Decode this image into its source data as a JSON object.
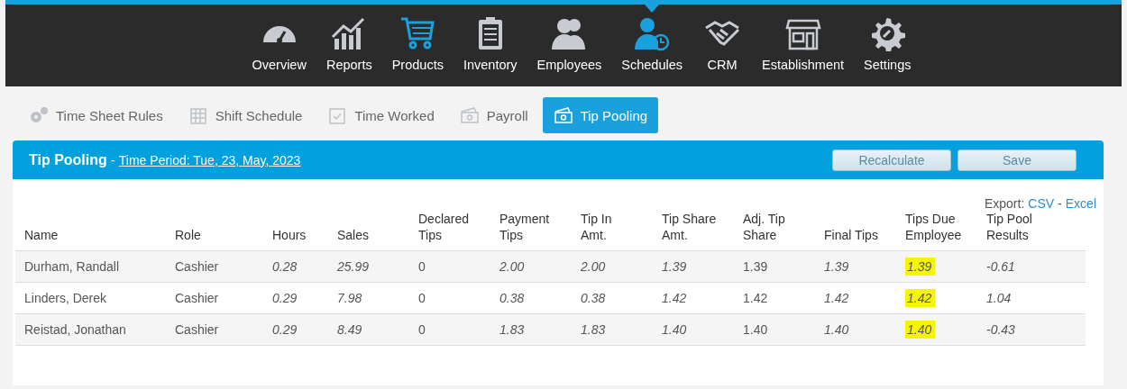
{
  "nav": [
    {
      "label": "Overview",
      "selected": false,
      "highlighted": false
    },
    {
      "label": "Reports",
      "selected": false,
      "highlighted": false
    },
    {
      "label": "Products",
      "selected": false,
      "highlighted": true
    },
    {
      "label": "Inventory",
      "selected": false,
      "highlighted": false
    },
    {
      "label": "Employees",
      "selected": false,
      "highlighted": false
    },
    {
      "label": "Schedules",
      "selected": true,
      "highlighted": false
    },
    {
      "label": "CRM",
      "selected": false,
      "highlighted": false
    },
    {
      "label": "Establishment",
      "selected": false,
      "highlighted": false
    },
    {
      "label": "Settings",
      "selected": false,
      "highlighted": false
    }
  ],
  "subtabs": [
    {
      "label": "Time Sheet Rules",
      "selected": false
    },
    {
      "label": "Shift Schedule",
      "selected": false
    },
    {
      "label": "Time Worked",
      "selected": false
    },
    {
      "label": "Payroll",
      "selected": false
    },
    {
      "label": "Tip Pooling",
      "selected": true
    }
  ],
  "panel": {
    "title": "Tip Pooling",
    "separator": "-",
    "period_link": "Time Period: Tue, 23, May, 2023",
    "buttons": [
      "Recalculate",
      "Save"
    ]
  },
  "export": {
    "label": "Export:",
    "links": [
      "CSV",
      "Excel"
    ],
    "separator": "-"
  },
  "table": {
    "columns": [
      "Name",
      "Role",
      "Hours",
      "Sales",
      "Declared Tips",
      "Payment Tips",
      "Tip In Amt.",
      "Tip Share Amt.",
      "Adj. Tip Share",
      "Final Tips",
      "Tips Due Employee",
      "Tip Pool Results"
    ],
    "rows": [
      {
        "cells": [
          "Durham, Randall",
          "Cashier",
          "0.28",
          "25.99",
          "0",
          "2.00",
          "2.00",
          "1.39",
          "1.39",
          "1.39",
          "1.39",
          "-0.61"
        ],
        "tips_due_highlighted": true
      },
      {
        "cells": [
          "Linders, Derek",
          "Cashier",
          "0.29",
          "7.98",
          "0",
          "0.38",
          "0.38",
          "1.42",
          "1.42",
          "1.42",
          "1.42",
          "1.04"
        ],
        "tips_due_highlighted": true
      },
      {
        "cells": [
          "Reistad, Jonathan",
          "Cashier",
          "0.29",
          "8.49",
          "0",
          "1.83",
          "1.83",
          "1.40",
          "1.40",
          "1.40",
          "1.40",
          "-0.43"
        ],
        "tips_due_highlighted": true
      }
    ]
  }
}
